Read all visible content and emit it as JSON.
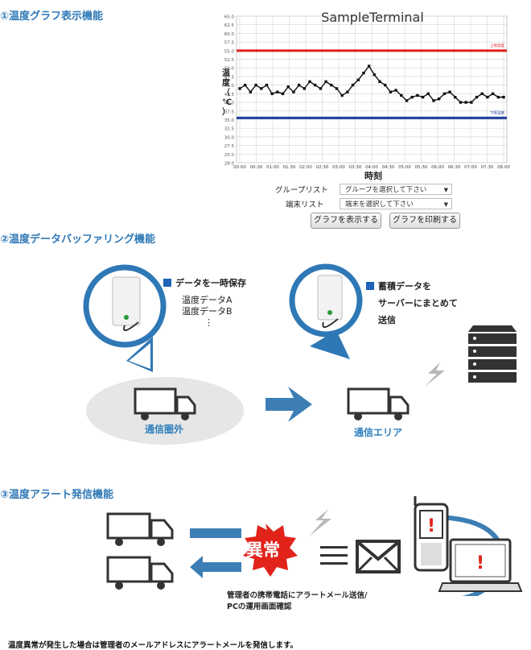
{
  "section1": {
    "title": "①温度グラフ表示機能"
  },
  "chart_data": {
    "type": "line",
    "title": "SampleTerminal",
    "xlabel": "時刻",
    "ylabel": "温度（℃）",
    "ylim": [
      28.0,
      65.0
    ],
    "yticks": [
      "65.0",
      "62.5",
      "60.0",
      "57.5",
      "55.0",
      "52.5",
      "50.0",
      "47.5",
      "45.0",
      "42.5",
      "40.0",
      "37.5",
      "35.0",
      "32.5",
      "30.0",
      "27.5",
      "25.0",
      "28.0"
    ],
    "xticks": [
      "00:00",
      "00:30",
      "01:00",
      "01:30",
      "02:00",
      "02:30",
      "03:00",
      "03:30",
      "04:00",
      "04:30",
      "05:00",
      "05:30",
      "06:00",
      "06:30",
      "07:00",
      "07:30",
      "08:00"
    ],
    "upper_limit": {
      "label": "上限温度",
      "value": 55.0,
      "color": "#e11d1d"
    },
    "lower_limit": {
      "label": "下限温度",
      "value": 35.5,
      "color": "#1c3f9e"
    },
    "series": [
      {
        "color": "#111111",
        "values": [
          44.0,
          45.0,
          43.0,
          45.0,
          44.0,
          45.0,
          42.5,
          43.0,
          42.5,
          44.5,
          43.0,
          45.0,
          44.0,
          46.0,
          45.0,
          44.0,
          46.0,
          45.0,
          44.0,
          42.0,
          43.0,
          45.0,
          46.5,
          48.5,
          50.5,
          48.0,
          46.0,
          45.0,
          43.0,
          43.5,
          42.0,
          40.5,
          41.5,
          42.0,
          41.5,
          42.5,
          40.5,
          41.0,
          42.5,
          43.0,
          41.5,
          40.0,
          40.0,
          40.0,
          41.5,
          42.5,
          41.5,
          42.5,
          41.5,
          41.5
        ]
      }
    ]
  },
  "controls": {
    "group_label": "グループリスト",
    "group_value": "グループを選択して下さい",
    "terminal_label": "端末リスト",
    "terminal_value": "端末を選択して下さい",
    "show_button": "グラフを表示する",
    "print_button": "グラフを印刷する"
  },
  "section2": {
    "title": "②温度データバッファリング機能",
    "bubble1_heading": "データを一時保存",
    "bubble1_items": [
      "温度データA",
      "温度データB",
      "⋮"
    ],
    "bubble2_heading": "蓄積データを",
    "bubble2_lines": [
      "サーバーにまとめて",
      "送信"
    ],
    "out_of_range": "通信圏外",
    "in_range": "通信エリア"
  },
  "section3": {
    "title": "③温度アラート発信機能",
    "alert": "異常",
    "caption_lines": [
      "管理者の携帯電話にアラートメール送信/",
      "PCの運用画面確認"
    ],
    "footer": "温度異常が発生した場合は管理者のメールアドレスにアラートメールを発信します。"
  },
  "colors": {
    "accent": "#2f78b6",
    "arrow": "#3d7fb5",
    "alert": "#e2231a"
  }
}
